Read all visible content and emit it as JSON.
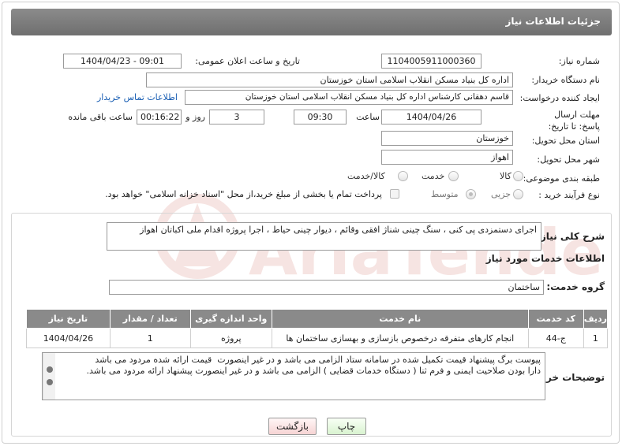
{
  "header": {
    "title": "جزئیات اطلاعات نیاز"
  },
  "fields": {
    "need_number_label": "شماره نیاز:",
    "need_number": "1104005911000360",
    "announce_label": "تاریخ و ساعت اعلان عمومی:",
    "announce_value": "1404/04/23 - 09:01",
    "buyer_org_label": "نام دستگاه خریدار:",
    "buyer_org": "اداره کل بنیاد مسکن انقلاب اسلامی استان خوزستان",
    "creator_label": "ایجاد کننده درخواست:",
    "creator": "قاسم دهقانی کارشناس اداره کل بنیاد مسکن انقلاب اسلامی استان خوزستان",
    "contact_link": "اطلاعات تماس خریدار",
    "deadline_label": "مهلت ارسال پاسخ: تا تاریخ:",
    "deadline_date": "1404/04/26",
    "time_label": "ساعت",
    "deadline_time": "09:30",
    "days_value": "3",
    "days_label": "روز و",
    "remaining_time": "00:16:22",
    "remaining_label": "ساعت باقی مانده",
    "province_label": "استان محل تحویل:",
    "province": "خوزستان",
    "city_label": "شهر محل تحویل:",
    "city": "اهواز",
    "category_label": "طبقه بندی موضوعی:",
    "category_options": [
      "کالا",
      "خدمت",
      "کالا/خدمت"
    ],
    "process_label": "نوع فرآیند خرید :",
    "process_options": [
      "جزیی",
      "متوسط"
    ],
    "payment_note": "پرداخت تمام یا بخشی از مبلغ خرید،از محل \"اسناد خزانه اسلامی\" خواهد بود."
  },
  "summary": {
    "label": "شرح کلی نیاز:",
    "text": "اجرای دستمزدی پی کنی ، سنگ چینی شناژ افقی وقائم ، دیوار چینی حیاط ، اجرا پروژه  اقدام ملی اکباتان اهواز"
  },
  "services": {
    "section_title": "اطلاعات خدمات مورد نیاز",
    "group_label": "گروه خدمت:",
    "group_value": "ساختمان",
    "columns": [
      "ردیف",
      "کد خدمت",
      "نام خدمت",
      "واحد اندازه گیری",
      "تعداد / مقدار",
      "تاریخ نیاز"
    ],
    "rows": [
      [
        "1",
        "ج-44",
        "انجام کارهای متفرقه درخصوص بازسازی و بهسازی ساختمان ها",
        "پروژه",
        "1",
        "1404/04/26"
      ]
    ]
  },
  "buyer_notes": {
    "label": "توضیحات خریدار:",
    "text": "پیوست برگ پیشنهاد قیمت تکمیل شده در سامانه ستاد الزامی می باشد و در غیر اینصورت  قیمت ارائه شده مردود می باشد\nدارا بودن صلاحیت ایمنی و فرم ثنا ( دستگاه خدمات قضایی ) الزامی می باشد و در غیر اینصورت پیشنهاد ارائه مردود می باشد."
  },
  "buttons": {
    "print": "چاپ",
    "back": "بازگشت"
  },
  "watermark": "AriaTender.neT",
  "colors": {
    "header": "#7d7d7d",
    "link": "#1a5fb4",
    "table_header": "#8a8a8a",
    "watermark": "#c0392b"
  }
}
